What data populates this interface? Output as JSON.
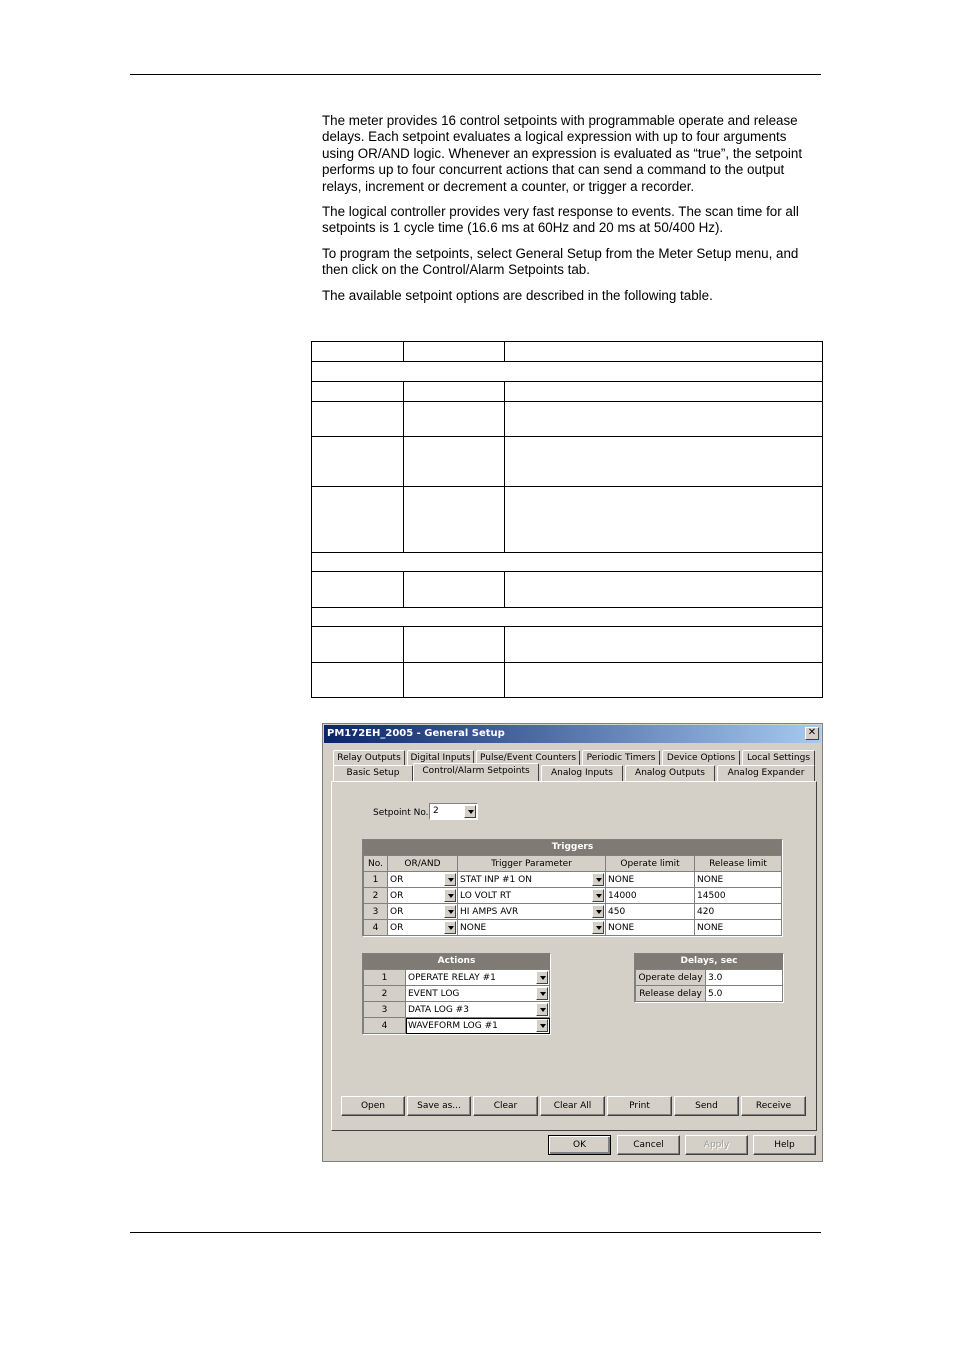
{
  "page": {
    "paragraphs": [
      "The meter provides 16 control setpoints with programmable operate and release delays. Each setpoint evaluates a logical expression with up to four arguments using OR/AND logic. Whenever an expression is evaluated as “true”, the setpoint performs up to four concurrent actions that can send a command to the output relays, increment or decrement a counter, or trigger a recorder.",
      "The logical controller provides very fast response to events. The scan time for all setpoints is 1 cycle time (16.6 ms at 60Hz and 20 ms at 50/400 Hz).",
      "To program the setpoints, select General Setup from the Meter Setup menu, and then click on the Control/Alarm Setpoints tab.",
      "The available setpoint options are described in the following table."
    ]
  },
  "dialog": {
    "title": "PM172EH_2005 - General Setup",
    "close_icon": "close-icon",
    "tabs_row1": [
      "Relay Outputs",
      "Digital Inputs",
      "Pulse/Event Counters",
      "Periodic Timers",
      "Device Options",
      "Local Settings"
    ],
    "tabs_row2": [
      "Basic Setup",
      "Control/Alarm Setpoints",
      "Analog Inputs",
      "Analog Outputs",
      "Analog Expander"
    ],
    "active_tab": "Control/Alarm Setpoints",
    "setpoint_label": "Setpoint No.",
    "setpoint_value": "2",
    "triggers": {
      "title": "Triggers",
      "headers": [
        "No.",
        "OR/AND",
        "Trigger Parameter",
        "Operate limit",
        "Release limit"
      ],
      "rows": [
        {
          "no": "1",
          "logic": "OR",
          "param": "STAT INP #1 ON",
          "operate": "NONE",
          "release": "NONE"
        },
        {
          "no": "2",
          "logic": "OR",
          "param": "LO VOLT RT",
          "operate": "14000",
          "release": "14500"
        },
        {
          "no": "3",
          "logic": "OR",
          "param": "HI AMPS AVR",
          "operate": "450",
          "release": "420"
        },
        {
          "no": "4",
          "logic": "OR",
          "param": "NONE",
          "operate": "NONE",
          "release": "NONE"
        }
      ]
    },
    "actions": {
      "title": "Actions",
      "rows": [
        {
          "no": "1",
          "action": "OPERATE RELAY #1"
        },
        {
          "no": "2",
          "action": "EVENT LOG"
        },
        {
          "no": "3",
          "action": "DATA LOG #3"
        },
        {
          "no": "4",
          "action": "WAVEFORM LOG #1"
        }
      ]
    },
    "delays": {
      "title": "Delays, sec",
      "operate_label": "Operate delay",
      "operate_value": "3.0",
      "release_label": "Release delay",
      "release_value": "5.0"
    },
    "panel_buttons": [
      "Open",
      "Save as...",
      "Clear",
      "Clear All",
      "Print",
      "Send",
      "Receive"
    ],
    "dialog_buttons": {
      "ok": "OK",
      "cancel": "Cancel",
      "apply": "Apply",
      "help": "Help"
    }
  }
}
